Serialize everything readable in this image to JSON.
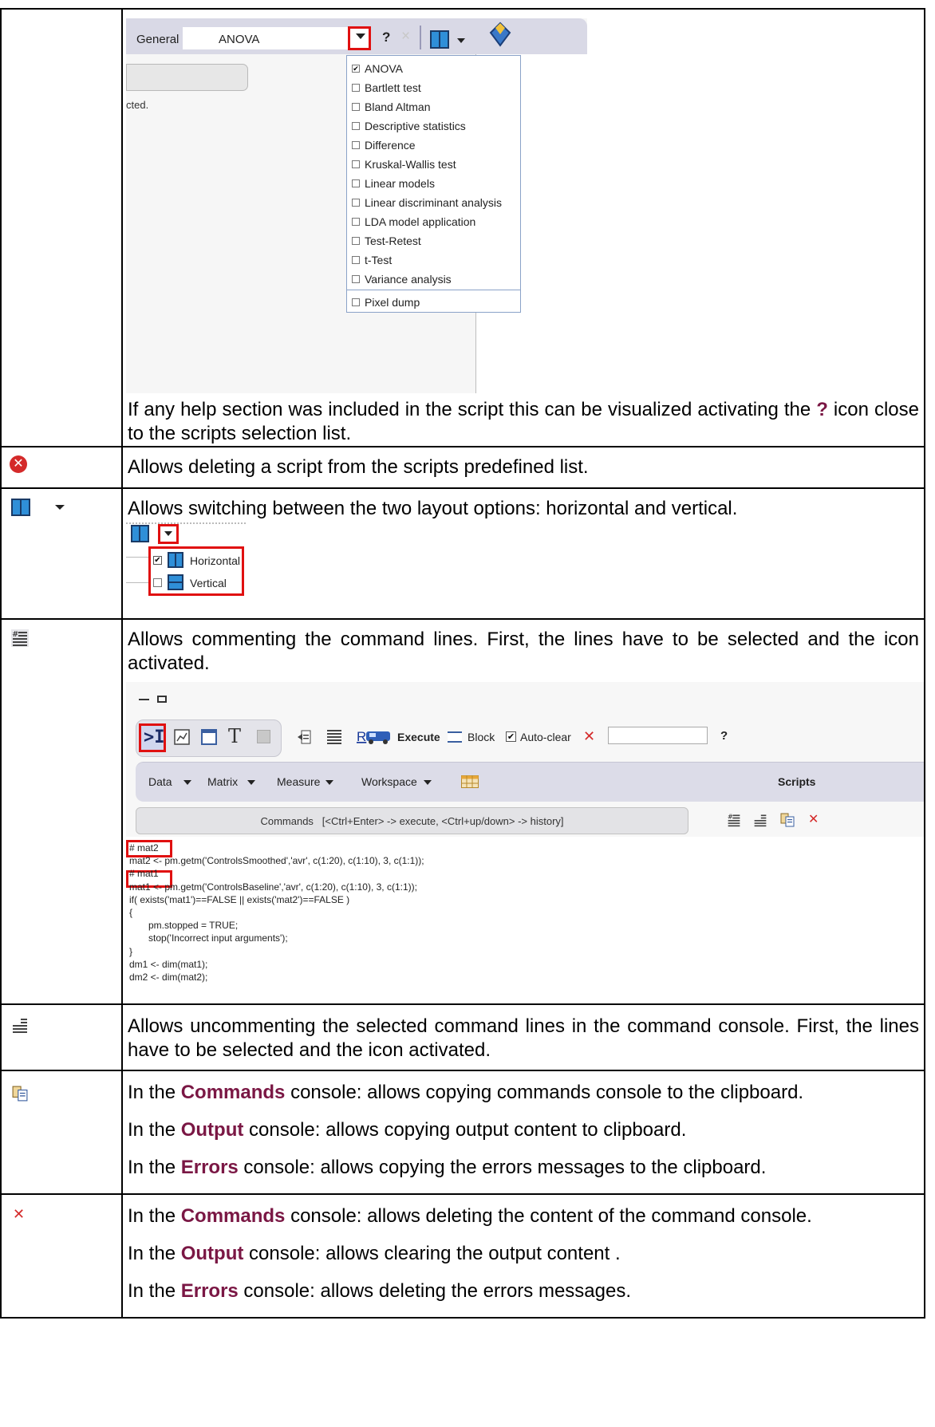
{
  "colors": {
    "keyword": "#7a1744",
    "highlight_box": "#e01010",
    "icon_blue": "#2f8fd8",
    "delete_red": "#d42a2a"
  },
  "row1": {
    "screenshot": {
      "tab_general": "General",
      "script_selected": "ANOVA",
      "help_glyph": "?",
      "close_glyph": "×",
      "status_fragment": "cted.",
      "dropdown_items": [
        {
          "label": "ANOVA",
          "checked": true
        },
        {
          "label": "Bartlett test",
          "checked": false
        },
        {
          "label": "Bland Altman",
          "checked": false
        },
        {
          "label": "Descriptive statistics",
          "checked": false
        },
        {
          "label": "Difference",
          "checked": false
        },
        {
          "label": "Kruskal-Wallis test",
          "checked": false
        },
        {
          "label": "Linear models",
          "checked": false
        },
        {
          "label": "Linear discriminant analysis",
          "checked": false
        },
        {
          "label": "LDA model application",
          "checked": false
        },
        {
          "label": "Test-Retest",
          "checked": false
        },
        {
          "label": "t-Test",
          "checked": false
        },
        {
          "label": "Variance analysis",
          "checked": false
        }
      ],
      "dropdown_extra": "Pixel dump"
    },
    "desc_before": "If any help section was included in the script this can be visualized activating the ",
    "desc_kw": "?",
    "desc_after": " icon close to the scripts selection list."
  },
  "row2": {
    "icon": "delete-script-icon",
    "desc": "Allows deleting a script from the scripts predefined list."
  },
  "row3": {
    "icon": "layout-icon",
    "desc": "Allows switching between the two layout options: horizontal and vertical.",
    "menu": [
      {
        "label": "Horizontal",
        "checked": true
      },
      {
        "label": "Vertical",
        "checked": false
      }
    ]
  },
  "row4": {
    "icon": "comment-lines-icon",
    "desc": "Allows commenting the command lines. First, the lines have to be selected and the icon activated.",
    "screenshot": {
      "execute_label": "Execute",
      "block_label": "Block",
      "autoclear_label": "Auto-clear",
      "help_glyph": "?",
      "menus": [
        "Data",
        "Matrix",
        "Measure",
        "Workspace"
      ],
      "scripts_label": "Scripts",
      "commands_header": "Commands   [<Ctrl+Enter> -> execute, <Ctrl+up/down> -> history]",
      "code_lines": [
        "# mat2",
        "mat2 <- pm.getm('ControlsSmoothed','avr', c(1:20), c(1:10), 3, c(1:1));",
        "# mat1",
        "mat1 <- pm.getm('ControlsBaseline','avr', c(1:20), c(1:10), 3, c(1:1));",
        "if( exists('mat1')==FALSE || exists('mat2')==FALSE )",
        "{",
        "pm.stopped = TRUE;",
        "stop('Incorrect input arguments');",
        "}",
        "dm1 <- dim(mat1);",
        "dm2 <- dim(mat2);"
      ]
    }
  },
  "row5": {
    "icon": "uncomment-lines-icon",
    "desc": "Allows uncommenting the selected command lines in the command console. First, the lines have to be selected and the icon activated."
  },
  "row6": {
    "icon": "copy-clipboard-icon",
    "lines": [
      {
        "pre": "In the ",
        "kw": "Commands",
        "post": " console: allows copying commands console to the clipboard."
      },
      {
        "pre": "In the ",
        "kw": "Output",
        "post": " console: allows copying output content to clipboard."
      },
      {
        "pre": "In the ",
        "kw": "Errors",
        "post": " console: allows copying the errors messages to the clipboard."
      }
    ]
  },
  "row7": {
    "icon": "delete-content-icon",
    "lines": [
      {
        "pre": "In the ",
        "kw": "Commands",
        "post": " console: allows deleting the content of the command console."
      },
      {
        "pre": "In the ",
        "kw": "Output",
        "post": " console: allows clearing the output content ."
      },
      {
        "pre": "In the ",
        "kw": "Errors",
        "post": " console: allows deleting the errors messages."
      }
    ]
  }
}
